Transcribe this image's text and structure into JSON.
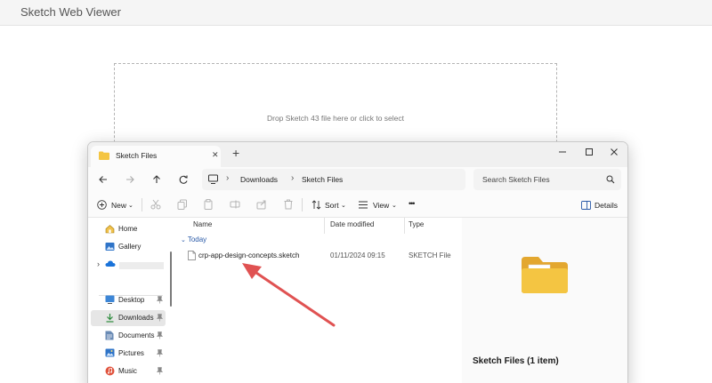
{
  "app": {
    "title": "Sketch Web Viewer"
  },
  "dropzone": {
    "text": "Drop Sketch 43 file here or click to select"
  },
  "explorer": {
    "tab": {
      "title": "Sketch Files"
    },
    "address": {
      "crumbs": [
        "Downloads",
        "Sketch Files"
      ]
    },
    "search": {
      "placeholder": "Search Sketch Files"
    },
    "toolbar": {
      "new_label": "New",
      "sort_label": "Sort",
      "view_label": "View",
      "more_label": "•••",
      "details_label": "Details"
    },
    "sidebar": {
      "items": [
        {
          "label": "Home",
          "icon": "home-icon"
        },
        {
          "label": "Gallery",
          "icon": "gallery-icon"
        },
        {
          "label": "",
          "icon": "onedrive-icon"
        },
        {
          "label": "Desktop",
          "icon": "desktop-icon",
          "pinned": true
        },
        {
          "label": "Downloads",
          "icon": "download-icon",
          "pinned": true,
          "selected": true
        },
        {
          "label": "Documents",
          "icon": "documents-icon",
          "pinned": true
        },
        {
          "label": "Pictures",
          "icon": "pictures-icon",
          "pinned": true
        },
        {
          "label": "Music",
          "icon": "music-icon",
          "pinned": true
        }
      ]
    },
    "columns": [
      "Name",
      "Date modified",
      "Type"
    ],
    "group": "Today",
    "files": [
      {
        "name": "crp-app-design-concepts.sketch",
        "date": "01/11/2024 09:15",
        "type": "SKETCH File"
      }
    ],
    "details": {
      "title": "Sketch Files (1 item)"
    }
  },
  "annotation": {
    "color": "#e05252"
  },
  "colors": {
    "accent": "#2a5aa8",
    "folder": "#f4c542"
  }
}
